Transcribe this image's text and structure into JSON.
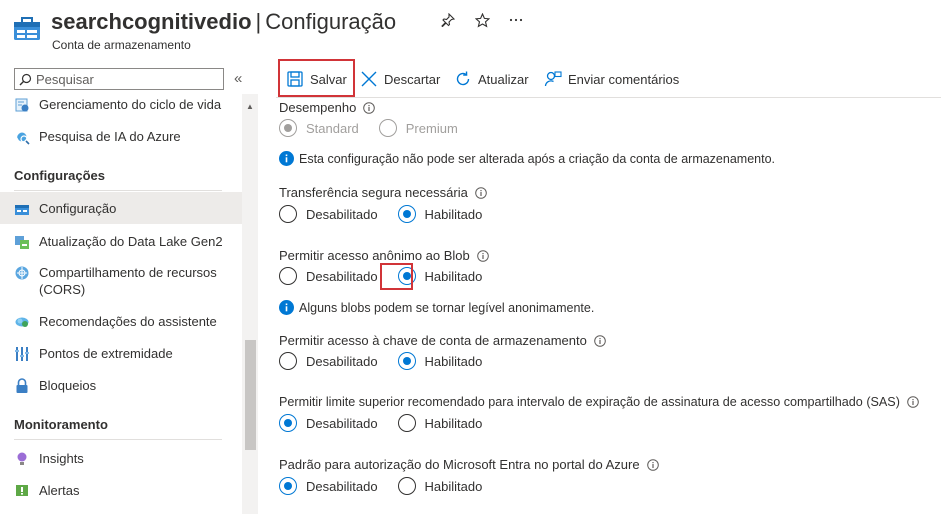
{
  "header": {
    "resource_name": "searchcognitivedio",
    "separator": "|",
    "blade_title": "Configuração",
    "subtitle": "Conta de armazenamento",
    "pin_icon": "pin-icon",
    "favorite_icon": "star-icon",
    "more_icon": "ellipsis-icon"
  },
  "sidebar": {
    "search_placeholder": "Pesquisar",
    "collapse_glyph": "«",
    "items_top": [
      {
        "label": "Gerenciamento do ciclo de vida",
        "icon": "lifecycle-icon"
      },
      {
        "label": "Pesquisa de IA do Azure",
        "icon": "ai-search-icon"
      }
    ],
    "section_settings": "Configurações",
    "items_settings": [
      {
        "label": "Configuração",
        "icon": "storage-config-icon",
        "active": true
      },
      {
        "label": "Atualização do Data Lake Gen2",
        "icon": "data-lake-icon"
      },
      {
        "label": "Compartilhamento de recursos (CORS)",
        "icon": "cors-icon"
      },
      {
        "label": "Recomendações do assistente",
        "icon": "advisor-icon"
      },
      {
        "label": "Pontos de extremidade",
        "icon": "endpoints-icon"
      },
      {
        "label": "Bloqueios",
        "icon": "lock-icon"
      }
    ],
    "section_monitoring": "Monitoramento",
    "items_monitoring": [
      {
        "label": "Insights",
        "icon": "insights-icon"
      },
      {
        "label": "Alertas",
        "icon": "alerts-icon"
      }
    ]
  },
  "toolbar": {
    "save": "Salvar",
    "discard": "Descartar",
    "refresh": "Atualizar",
    "feedback": "Enviar comentários"
  },
  "settings": {
    "performance": {
      "label": "Desempenho",
      "options": [
        "Standard",
        "Premium"
      ],
      "selected": "Standard",
      "disabled": true,
      "note": "Esta configuração não pode ser alterada após a criação da conta de armazenamento."
    },
    "secure_transfer": {
      "label": "Transferência segura necessária",
      "options": [
        "Desabilitado",
        "Habilitado"
      ],
      "selected": "Habilitado"
    },
    "blob_anonymous": {
      "label": "Permitir acesso anônimo ao Blob",
      "options": [
        "Desabilitado",
        "Habilitado"
      ],
      "selected": "Habilitado",
      "note": "Alguns blobs podem se tornar legível anonimamente."
    },
    "shared_key": {
      "label": "Permitir acesso à chave de conta de armazenamento",
      "options": [
        "Desabilitado",
        "Habilitado"
      ],
      "selected": "Habilitado"
    },
    "sas_expiry": {
      "label": "Permitir limite superior recomendado para intervalo de expiração de assinatura de acesso compartilhado (SAS)",
      "options": [
        "Desabilitado",
        "Habilitado"
      ],
      "selected": "Desabilitado"
    },
    "entra_default": {
      "label": "Padrão para autorização do Microsoft Entra no portal do Azure",
      "options": [
        "Desabilitado",
        "Habilitado"
      ],
      "selected": "Desabilitado"
    }
  },
  "colors": {
    "accent": "#0078d4",
    "highlight": "#d13438",
    "active_nav": "#edebe9"
  }
}
